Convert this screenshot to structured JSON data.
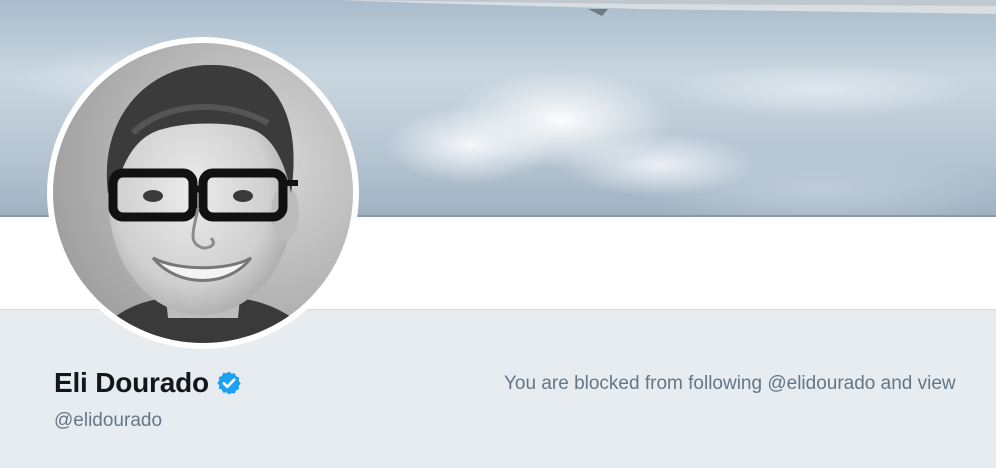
{
  "profile": {
    "display_name": "Eli Dourado",
    "handle": "@elidourado",
    "verified": true,
    "verified_icon": "verified-badge-icon",
    "blocked_message": "You are blocked from following @elidourado and view"
  },
  "colors": {
    "background": "#e6ecf0",
    "name": "#14171a",
    "secondary_text": "#657786",
    "verified_blue": "#1da1f2"
  }
}
